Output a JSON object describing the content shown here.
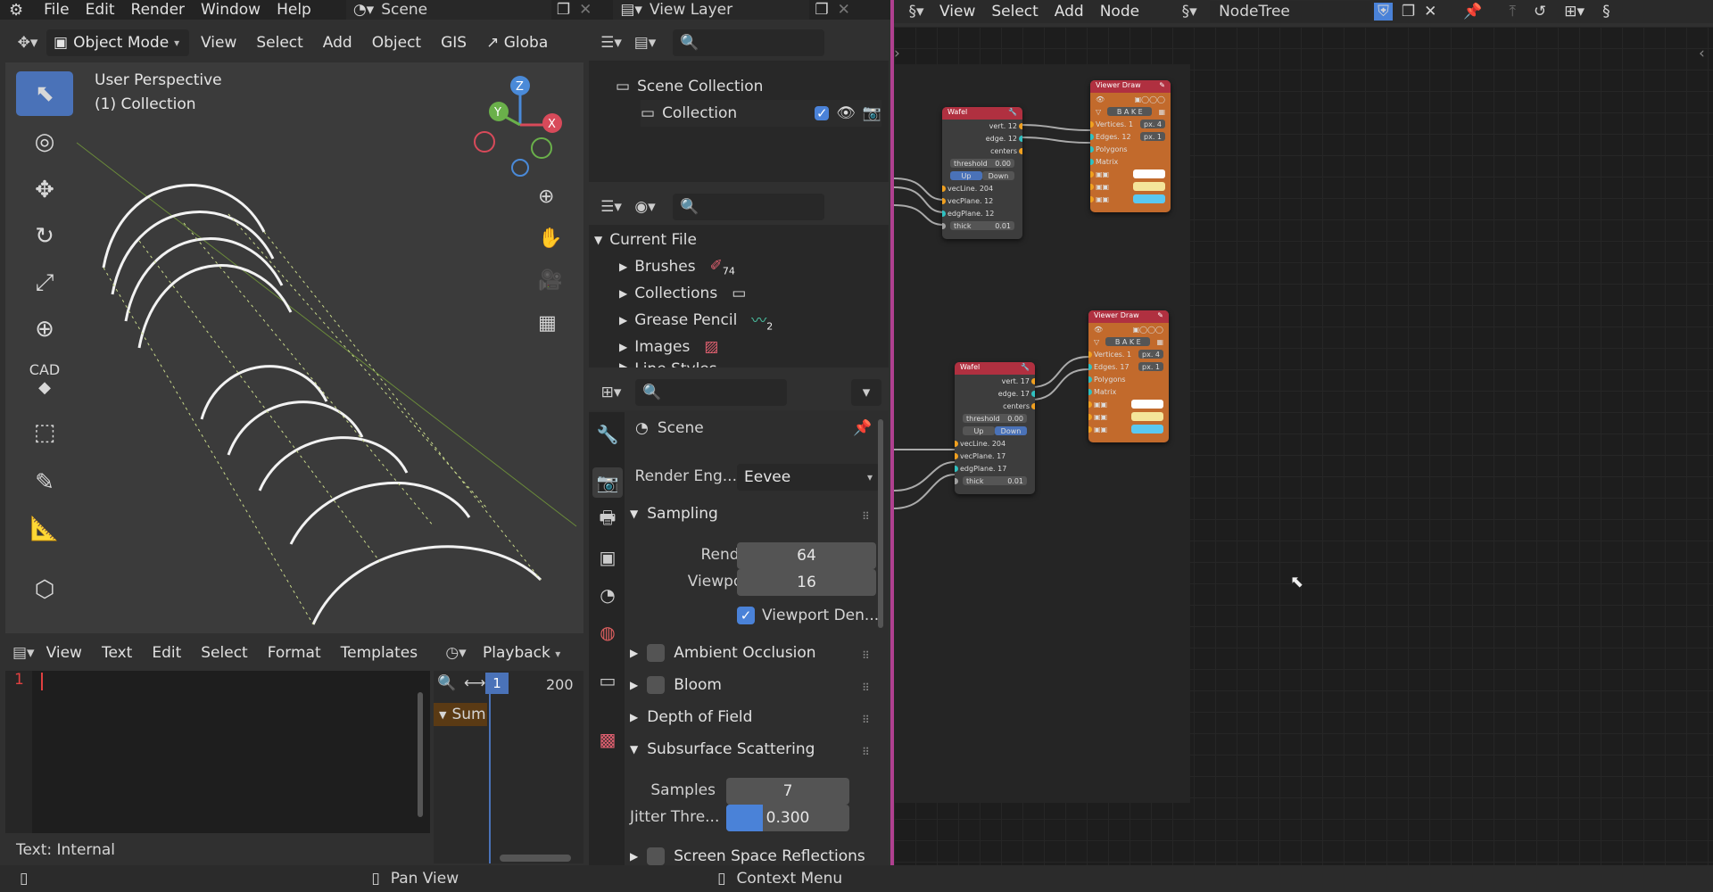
{
  "topbar": {
    "menus": [
      "File",
      "Edit",
      "Render",
      "Window",
      "Help"
    ],
    "scene_name": "Scene",
    "view_layer": "View Layer"
  },
  "viewport": {
    "header_items": [
      "View",
      "Select",
      "Add",
      "Object",
      "GIS"
    ],
    "mode": "Object Mode",
    "orientation": "Globa",
    "overlay_title": "User Perspective",
    "overlay_sub": "(1) Collection",
    "gizmo": {
      "z": "Z",
      "y": "Y",
      "x": "X"
    },
    "tools": [
      "select-box",
      "cursor",
      "move",
      "rotate",
      "scale",
      "transform",
      "cad",
      "select-tool",
      "annotate",
      "measure",
      "add-cube"
    ],
    "cad_label": "CAD"
  },
  "outliner": {
    "scene_collection": "Scene Collection",
    "collection": "Collection"
  },
  "blendfile": {
    "root": "Current File",
    "items": [
      {
        "label": "Brushes",
        "badge": "74"
      },
      {
        "label": "Collections",
        "badge": ""
      },
      {
        "label": "Grease Pencil",
        "badge": "2"
      },
      {
        "label": "Images",
        "badge": ""
      },
      {
        "label": "Line Styles",
        "badge": ""
      }
    ]
  },
  "properties": {
    "context": "Scene",
    "render_engine_label": "Render Eng...",
    "render_engine": "Eevee",
    "sampling": {
      "title": "Sampling",
      "render_label": "Render",
      "render_value": "64",
      "viewport_label": "Viewport",
      "viewport_value": "16",
      "denoise_label": "Viewport Den..."
    },
    "sections": [
      "Ambient Occlusion",
      "Bloom",
      "Depth of Field",
      "Subsurface Scattering"
    ],
    "sss": {
      "samples_label": "Samples",
      "samples_value": "7",
      "jitter_label": "Jitter Thre...",
      "jitter_value": "0.300",
      "jitter_fraction": 0.3
    },
    "ssr": "Screen Space Reflections"
  },
  "text_editor": {
    "menus": [
      "View",
      "Text",
      "Edit",
      "Select",
      "Format",
      "Templates"
    ],
    "line_number": "1",
    "footer": "Text: Internal"
  },
  "timeline": {
    "playback": "Playback",
    "frame_current": "1",
    "frame_end": "200",
    "summary": "Sum"
  },
  "node_editor": {
    "menus": [
      "View",
      "Select",
      "Add",
      "Node"
    ],
    "tree_name": "NodeTree",
    "nodes": {
      "wafel1": {
        "title": "Wafel",
        "outputs": [
          "vert. 12",
          "edge. 12",
          "centers"
        ],
        "threshold": "threshold",
        "threshold_value": "0.00",
        "up": "Up",
        "down": "Down",
        "inputs": [
          "vecLine. 204",
          "vecPlane. 12",
          "edgPlane. 12"
        ],
        "thick": "thick",
        "thick_value": "0.01"
      },
      "viewer1": {
        "title": "Viewer Draw",
        "bake": "B A K E",
        "rows": [
          "Vertices. 1",
          "Edges. 12",
          "Polygons",
          "Matrix"
        ],
        "px1": "px. 4",
        "px2": "px. 1"
      },
      "wafel2": {
        "title": "Wafel",
        "outputs": [
          "vert. 17",
          "edge. 17",
          "centers"
        ],
        "threshold": "threshold",
        "threshold_value": "0.00",
        "up": "Up",
        "down": "Down",
        "inputs": [
          "vecLine. 204",
          "vecPlane. 17",
          "edgPlane. 17"
        ],
        "thick": "thick",
        "thick_value": "0.01"
      },
      "viewer2": {
        "title": "Viewer Draw",
        "bake": "B A K E",
        "rows": [
          "Vertices. 1",
          "Edges. 17",
          "Polygons",
          "Matrix"
        ],
        "px1": "px. 4",
        "px2": "px. 1"
      }
    }
  },
  "statusbar": {
    "pan": "Pan View",
    "context": "Context Menu"
  }
}
